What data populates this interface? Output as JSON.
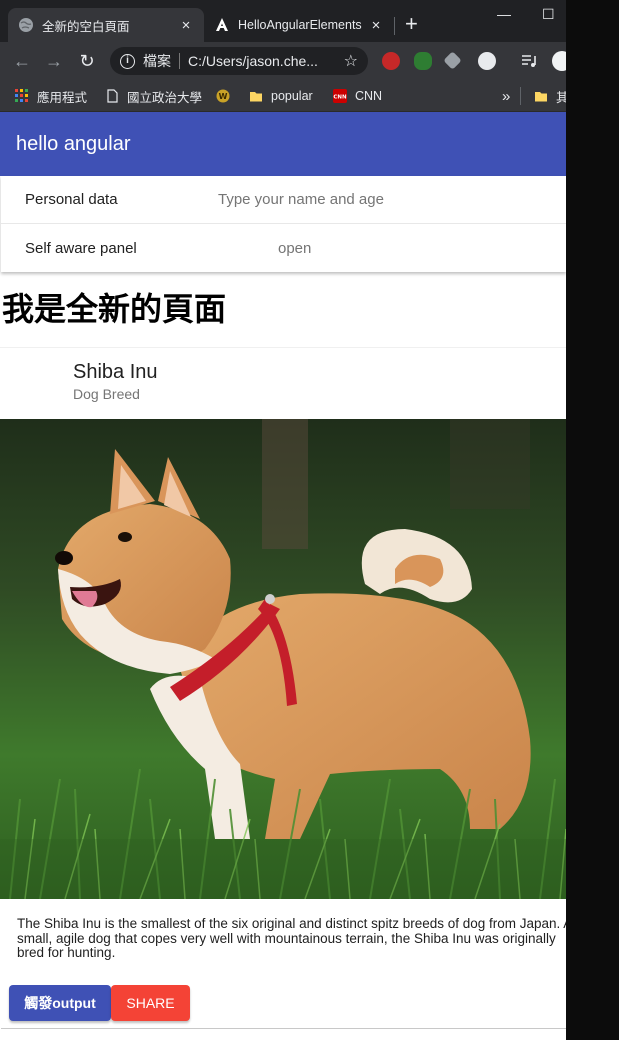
{
  "browser": {
    "tabs": [
      {
        "title": "全新的空白頁面",
        "close": "×",
        "active": true
      },
      {
        "title": "HelloAngularElements",
        "close": "×",
        "active": false
      }
    ],
    "new_tab": "+",
    "window_controls": {
      "minimize": "—",
      "maximize": "☐"
    },
    "nav": {
      "back": "←",
      "forward": "→",
      "reload": "↻"
    },
    "omnibox": {
      "info": "i",
      "scheme_label": "檔案",
      "url": "C:/Users/jason.che...",
      "star": "☆"
    },
    "extensions": [
      "abp-icon",
      "evernote-icon",
      "stack-icon",
      "circle-extension-icon",
      "playlist-icon",
      "profile-avatar"
    ],
    "bookmarks": [
      {
        "label": "應用程式",
        "icon": "apps-grid-icon"
      },
      {
        "label": "國立政治大學",
        "icon": "page-icon"
      },
      {
        "label": "",
        "icon": "warcraft-icon"
      },
      {
        "label": "popular",
        "icon": "folder-icon"
      },
      {
        "label": "CNN",
        "icon": "cnn-icon"
      }
    ],
    "bookmarks_overflow": "»",
    "bookmarks_other": "其"
  },
  "app": {
    "toolbar_title": "hello angular",
    "panels": [
      {
        "title": "Personal data",
        "description": "Type your name and age"
      },
      {
        "title": "Self aware panel",
        "description": "open"
      }
    ],
    "page_heading": "我是全新的頁面",
    "card": {
      "title": "Shiba Inu",
      "subtitle": "Dog Breed",
      "image_alt": "shiba-inu-photo",
      "content": "The Shiba Inu is the smallest of the six original and distinct spitz breeds of dog from Japan. A small, agile dog that copes very well with mountainous terrain, the Shiba Inu was originally bred for hunting.",
      "actions": {
        "output": "觸發output",
        "share": "SHARE"
      }
    }
  },
  "colors": {
    "primary": "#3f51b5",
    "warn": "#f44336",
    "chrome_dark": "#202124",
    "chrome_toolbar": "#35363a"
  }
}
